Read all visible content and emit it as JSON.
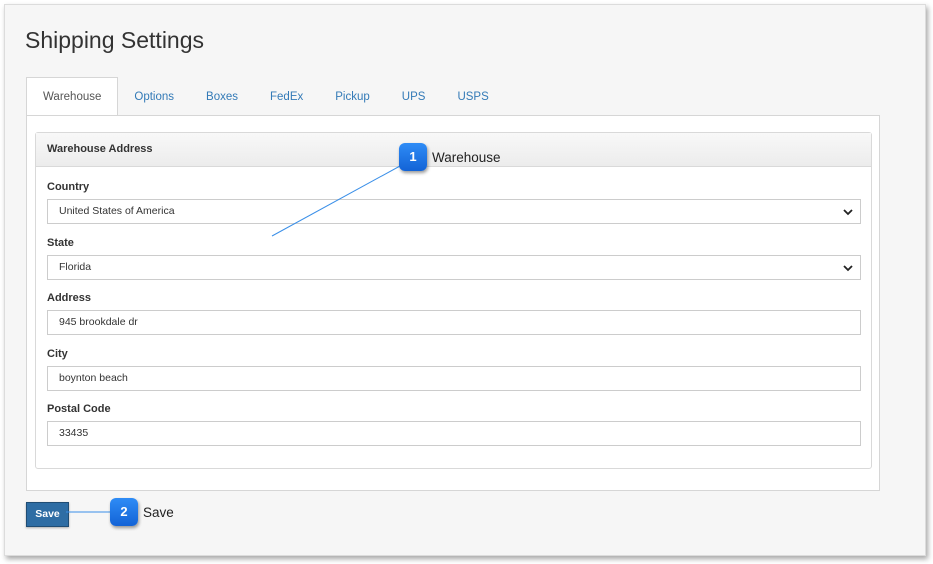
{
  "page": {
    "title": "Shipping Settings"
  },
  "tabs": [
    {
      "label": "Warehouse",
      "active": true
    },
    {
      "label": "Options",
      "active": false
    },
    {
      "label": "Boxes",
      "active": false
    },
    {
      "label": "FedEx",
      "active": false
    },
    {
      "label": "Pickup",
      "active": false
    },
    {
      "label": "UPS",
      "active": false
    },
    {
      "label": "USPS",
      "active": false
    }
  ],
  "warehouse_panel": {
    "heading": "Warehouse Address",
    "country": {
      "label": "Country",
      "value": "United States of America"
    },
    "state": {
      "label": "State",
      "value": "Florida"
    },
    "address": {
      "label": "Address",
      "value": "945 brookdale dr"
    },
    "city": {
      "label": "City",
      "value": "boynton beach"
    },
    "postal_code": {
      "label": "Postal Code",
      "value": "33435"
    }
  },
  "save_button": {
    "label": "Save"
  },
  "callouts": [
    {
      "number": "1",
      "text": "Warehouse"
    },
    {
      "number": "2",
      "text": "Save"
    }
  ],
  "colors": {
    "accent": "#337ab7",
    "button": "#2e6da4",
    "badge": "#1f78e8"
  }
}
